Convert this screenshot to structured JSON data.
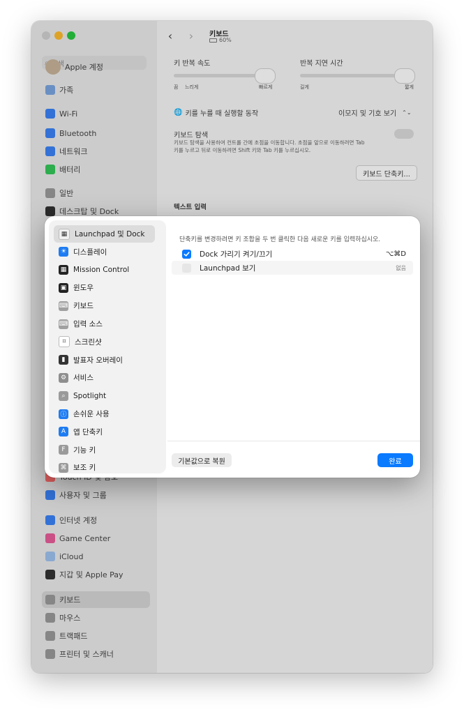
{
  "window": {
    "title": "키보드",
    "battery": "60%",
    "traffic_colors": [
      "#ff5f57",
      "#febc2e",
      "#28c840"
    ]
  },
  "search": {
    "placeholder": "검색"
  },
  "sidebar": {
    "items": [
      {
        "label": "Apple 계정",
        "icon": "avatar-icon",
        "color": "#c8b49a"
      },
      {
        "label": "가족",
        "icon": "family-icon",
        "color": "#7aa6e0"
      },
      {
        "label": "Wi-Fi",
        "icon": "wifi-icon",
        "color": "#3b82f6"
      },
      {
        "label": "Bluetooth",
        "icon": "bluetooth-icon",
        "color": "#3b82f6"
      },
      {
        "label": "네트워크",
        "icon": "network-icon",
        "color": "#3b82f6"
      },
      {
        "label": "배터리",
        "icon": "battery-icon",
        "color": "#34c759"
      },
      {
        "label": "일반",
        "icon": "gear-icon",
        "color": "#9a9a9a"
      },
      {
        "label": "데스크탑 및 Dock",
        "icon": "dock-icon",
        "color": "#333333"
      },
      {
        "label": "Touch ID 및 암호",
        "icon": "touchid-icon",
        "color": "#ff6b6b"
      },
      {
        "label": "사용자 및 그룹",
        "icon": "users-icon",
        "color": "#3b82f6"
      },
      {
        "label": "인터넷 계정",
        "icon": "internet-accounts-icon",
        "color": "#3b82f6"
      },
      {
        "label": "Game Center",
        "icon": "game-center-icon",
        "color": "#e85d9a"
      },
      {
        "label": "iCloud",
        "icon": "icloud-icon",
        "color": "#9fc3f0"
      },
      {
        "label": "지갑 및 Apple Pay",
        "icon": "wallet-icon",
        "color": "#333333"
      },
      {
        "label": "키보드",
        "icon": "keyboard-icon",
        "color": "#9a9a9a"
      },
      {
        "label": "마우스",
        "icon": "mouse-icon",
        "color": "#9a9a9a"
      },
      {
        "label": "트랙패드",
        "icon": "trackpad-icon",
        "color": "#9a9a9a"
      },
      {
        "label": "프린터 및 스캐너",
        "icon": "printer-icon",
        "color": "#9a9a9a"
      }
    ]
  },
  "keyboard": {
    "repeat_rate_label": "키 반복 속도",
    "repeat_rate_ticks": {
      "left": "끔",
      "mid": "느리게",
      "right": "빠르게"
    },
    "repeat_delay_label": "반복 지연 시간",
    "repeat_delay_ticks": {
      "left": "길게",
      "right": "짧게"
    },
    "globe_key_label": "키를 누를 때 실행할 동작",
    "globe_key_value": "이모지 및 기호 보기",
    "nav_title": "키보드 탐색",
    "nav_desc_1": "키보드 탐색을 사용하여 컨트롤 간에 초점을 이동합니다. 초점을 앞으로 이동하려면 Tab",
    "nav_desc_2": "키를 누르고 뒤로 이동하려면 Shift 키와 Tab 키를 누르십시오.",
    "shortcuts_button": "키보드 단축키...",
    "text_input_header": "텍스트 입력"
  },
  "modal": {
    "categories": [
      {
        "label": "Launchpad 및 Dock",
        "icon": "launchpad-icon",
        "color": "#f0f0f0",
        "selected": true
      },
      {
        "label": "디스플레이",
        "icon": "display-icon",
        "color": "#1e7cf2",
        "selected": false
      },
      {
        "label": "Mission Control",
        "icon": "mission-control-icon",
        "color": "#222222",
        "selected": false
      },
      {
        "label": "윈도우",
        "icon": "window-icon",
        "color": "#222222",
        "selected": false
      },
      {
        "label": "키보드",
        "icon": "keyboard-icon",
        "color": "#a0a0a0",
        "selected": false
      },
      {
        "label": "입력 소스",
        "icon": "input-source-icon",
        "color": "#a0a0a0",
        "selected": false
      },
      {
        "label": "스크린샷",
        "icon": "screenshot-icon",
        "color": "#ffffff",
        "selected": false
      },
      {
        "label": "발표자 오버레이",
        "icon": "presenter-overlay-icon",
        "color": "#333333",
        "selected": false
      },
      {
        "label": "서비스",
        "icon": "gear-services-icon",
        "color": "#8e8e8e",
        "selected": false
      },
      {
        "label": "Spotlight",
        "icon": "spotlight-icon",
        "color": "#9a9a9a",
        "selected": false
      },
      {
        "label": "손쉬운 사용",
        "icon": "accessibility-icon",
        "color": "#1e7cf2",
        "selected": false
      },
      {
        "label": "앱 단축키",
        "icon": "app-shortcuts-icon",
        "color": "#1e7cf2",
        "selected": false
      },
      {
        "label": "기능 키",
        "icon": "function-keys-icon",
        "color": "#9a9a9a",
        "selected": false
      },
      {
        "label": "보조 키",
        "icon": "modifier-keys-icon",
        "color": "#9a9a9a",
        "selected": false
      }
    ],
    "hint": "단축키를 변경하려면 키 조합을 두 번 클릭한 다음 새로운 키를 입력하십시오.",
    "shortcuts": [
      {
        "label": "Dock 가리기 켜기/끄기",
        "key": "⌥⌘D",
        "checked": true
      },
      {
        "label": "Launchpad 보기",
        "key": "없음",
        "checked": false
      }
    ],
    "restore_button": "기본값으로 복원",
    "done_button": "완료",
    "accent": "#0a7aff"
  }
}
